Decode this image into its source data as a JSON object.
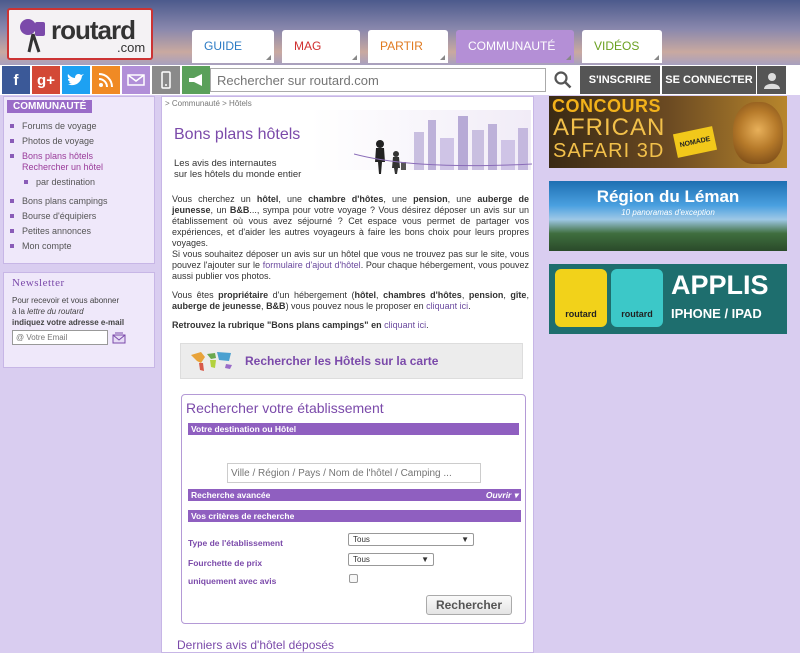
{
  "header": {
    "logo_text": "routard",
    "logo_com": ".com",
    "tabs": [
      {
        "label": "GUIDE",
        "color": "#2c7bc4"
      },
      {
        "label": "MAG",
        "color": "#d03030"
      },
      {
        "label": "PARTIR",
        "color": "#e07a20"
      },
      {
        "label": "COMMUNAUTÉ",
        "color": "#ffffff"
      },
      {
        "label": "VIDÉOS",
        "color": "#6aa020"
      }
    ]
  },
  "toolbar": {
    "social_icons": [
      "facebook-icon",
      "google-plus-icon",
      "twitter-icon",
      "rss-icon",
      "mail-icon",
      "mobile-icon",
      "megaphone-icon"
    ],
    "search_placeholder": "Rechercher sur routard.com",
    "signup_label": "S'INSCRIRE",
    "login_label": "SE CONNECTER"
  },
  "left_nav": {
    "section": "COMMUNAUTÉ",
    "items": [
      {
        "label": "Forums de voyage"
      },
      {
        "label": "Photos de voyage"
      },
      {
        "label": "Bons plans hôtels"
      },
      {
        "label": "Rechercher un hôtel"
      },
      {
        "label": "par destination"
      },
      {
        "label": "Bons plans campings"
      },
      {
        "label": "Bourse d'équipiers"
      },
      {
        "label": "Petites annonces"
      },
      {
        "label": "Mon compte"
      }
    ]
  },
  "newsletter": {
    "title": "Newsletter",
    "line1": "Pour recevoir et vous abonner",
    "line2_prefix": "à la ",
    "line2_italic": "lettre du routard",
    "line3": "indiquez votre adresse e-mail",
    "email_placeholder": "@ Votre Email"
  },
  "main": {
    "breadcrumb": "> Communauté > Hôtels",
    "title": "Bons plans hôtels",
    "subtitle_1": "Les avis des internautes",
    "subtitle_2": "sur les hôtels du monde entier",
    "p1": {
      "a": "Vous cherchez un ",
      "b1": "hôtel",
      "c": ", une ",
      "b2": "chambre d'hôtes",
      "d": ", une ",
      "b3": "pension",
      "e": ", une ",
      "b4": "auberge de jeunesse",
      "f": ", un ",
      "b5": "B&B",
      "g": "..., sympa pour votre voyage ? Vous désirez déposer un avis sur un établissement où vous avez séjourné ? Cet espace vous permet de partager vos expériences, et d'aider les autres voyageurs à faire les bons choix pour leurs propres voyages.",
      "h": "Si vous souhaitez déposer un avis sur un hôtel que vous ne trouvez pas sur le site, vous pouvez l'ajouter sur le ",
      "link": "formulaire d'ajout d'hôtel",
      "i": ". Pour chaque hébergement, vous pouvez aussi publier vos photos."
    },
    "p2": {
      "a": "Vous êtes ",
      "b1": "propriétaire",
      "c": " d'un hébergement (",
      "b2": "hôtel",
      "d": ", ",
      "b3": "chambres d'hôtes",
      "e": ", ",
      "b4": "pension",
      "f": ", ",
      "b5": "gîte",
      "g": ", ",
      "b6": "auberge de jeunesse",
      "h": ", ",
      "b7": "B&B",
      "i": ") vous pouvez nous le proposer en ",
      "link": "cliquant ici",
      "j": "."
    },
    "p3": {
      "b": "Retrouvez la rubrique \"Bons plans campings\" en ",
      "link": "cliquant ici",
      "end": "."
    },
    "map_link": "Rechercher les Hôtels sur la carte",
    "latest_title": "Derniers avis d'hôtel déposés"
  },
  "search_form": {
    "title": "Rechercher votre établissement",
    "dest_bar": "Votre destination ou Hôtel",
    "dest_placeholder": "Ville / Région / Pays / Nom de l'hôtel / Camping ...",
    "advanced_bar": "Recherche avancée",
    "advanced_toggle": "Ouvrir ▾",
    "criteria_bar": "Vos critères de recherche",
    "type_label": "Type de l'établissement",
    "type_value": "Tous",
    "price_label": "Fourchette de prix",
    "price_value": "Tous",
    "reviews_label": "uniquement avec avis",
    "submit_label": "Rechercher"
  },
  "ads": {
    "ad1": {
      "line1": "CONCOURS",
      "line2": "AFRICAN",
      "line3": "SAFARI 3D",
      "badge": "NOMADE"
    },
    "ad2": {
      "title": "Région du Léman",
      "subtitle": "10 panoramas d'exception"
    },
    "ad3": {
      "logo1": "routard",
      "logo2": "routard",
      "title": "APPLIS",
      "subtitle": "IPHONE / IPAD"
    }
  }
}
